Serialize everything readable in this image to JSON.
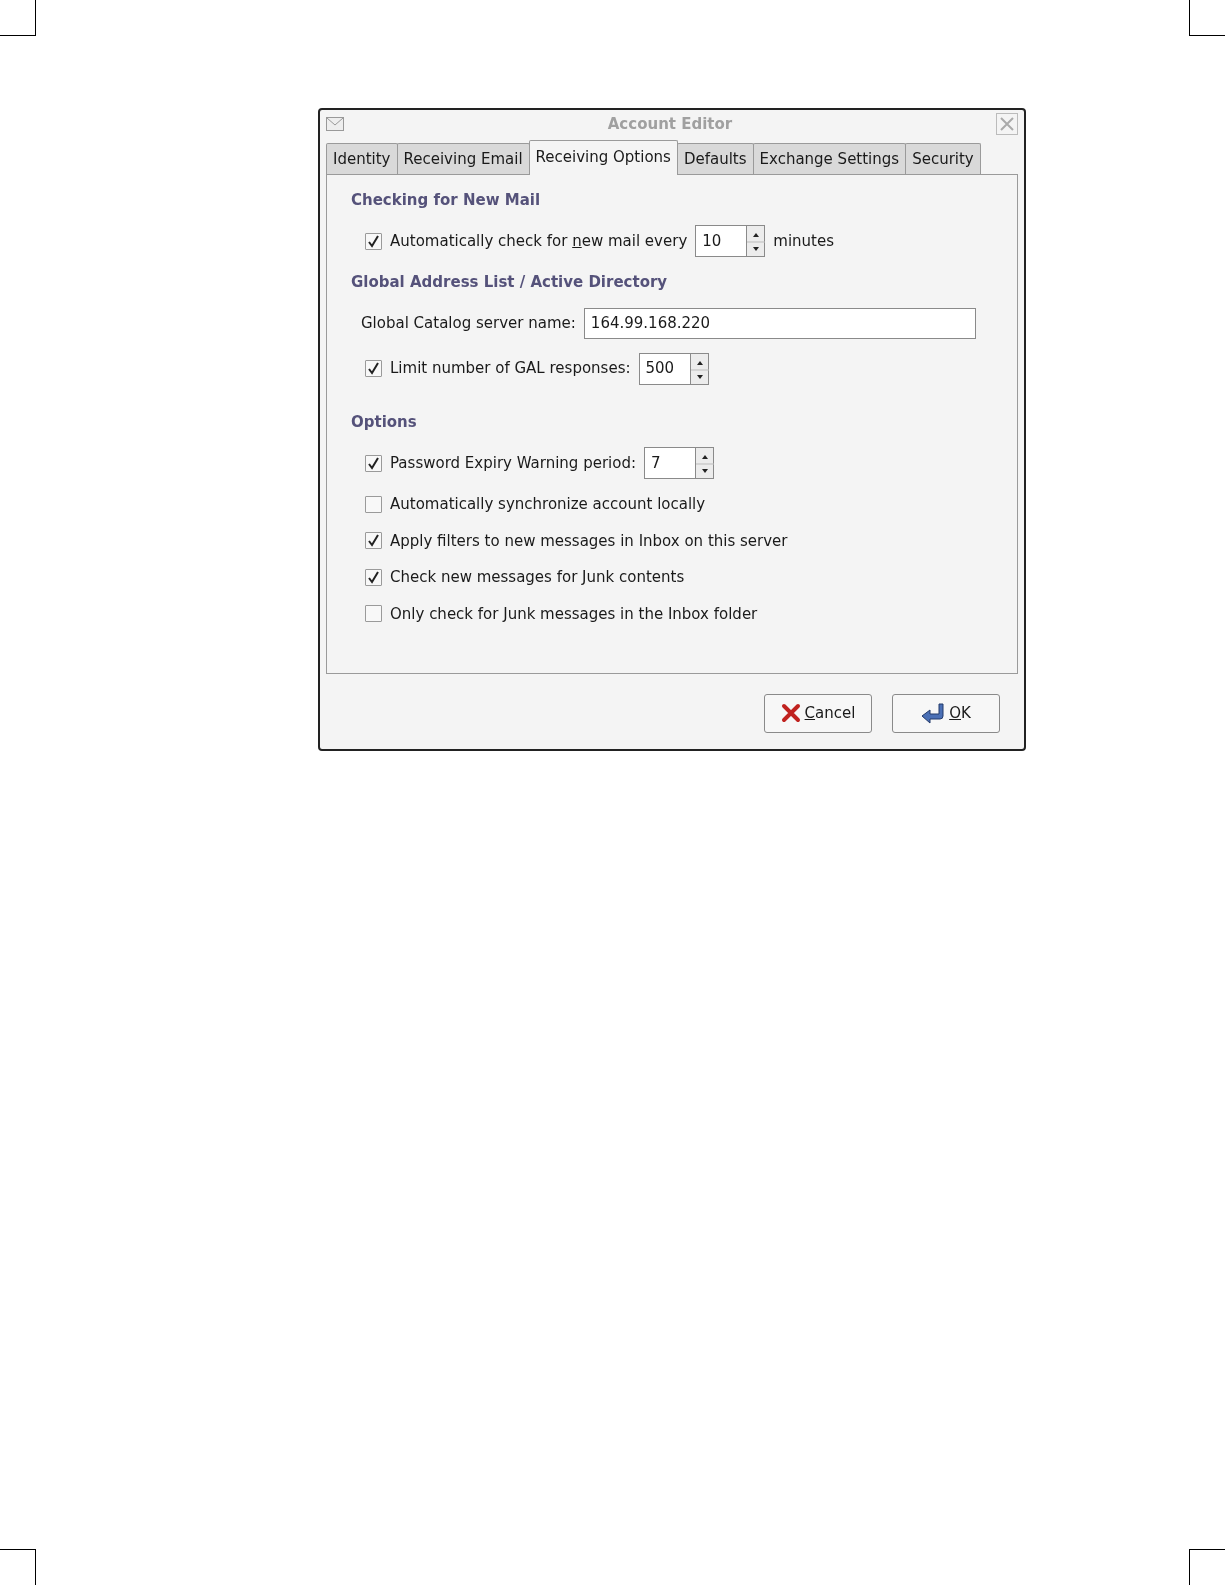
{
  "window": {
    "title": "Account Editor"
  },
  "tabs": [
    {
      "label": "Identity",
      "selected": false
    },
    {
      "label": "Receiving Email",
      "selected": false
    },
    {
      "label": "Receiving Options",
      "selected": true
    },
    {
      "label": "Defaults",
      "selected": false
    },
    {
      "label": "Exchange Settings",
      "selected": false
    },
    {
      "label": "Security",
      "selected": false
    }
  ],
  "sections": [
    {
      "heading": "Checking for New Mail",
      "rows": [
        {
          "kind": "check_spin",
          "checked": true,
          "label_before": "Automatically check for ",
          "access_key": "n",
          "label_after": "ew mail every",
          "value": "10",
          "suffix": "minutes"
        }
      ]
    },
    {
      "heading": "Global Address List / Active Directory",
      "rows": [
        {
          "kind": "text_field",
          "label": "Global Catalog server name:",
          "value": "164.99.168.220"
        },
        {
          "kind": "check_spin",
          "checked": true,
          "label": "Limit number of GAL responses:",
          "value": "500"
        }
      ]
    },
    {
      "heading": "Options",
      "rows": [
        {
          "kind": "check_spin",
          "checked": true,
          "label": "Password Expiry Warning period:",
          "value": "7"
        },
        {
          "kind": "check",
          "checked": false,
          "label": "Automatically synchronize account locally"
        },
        {
          "kind": "check",
          "checked": true,
          "label": "Apply filters to new messages in Inbox on this server"
        },
        {
          "kind": "check",
          "checked": true,
          "label": "Check new messages for Junk contents"
        },
        {
          "kind": "check",
          "checked": false,
          "label": "Only check for Junk messages in the Inbox folder"
        }
      ]
    }
  ],
  "buttons": [
    {
      "kind": "cancel",
      "access_key": "C",
      "label_after": "ancel"
    },
    {
      "kind": "ok",
      "access_key": "O",
      "label_after": "K"
    }
  ]
}
